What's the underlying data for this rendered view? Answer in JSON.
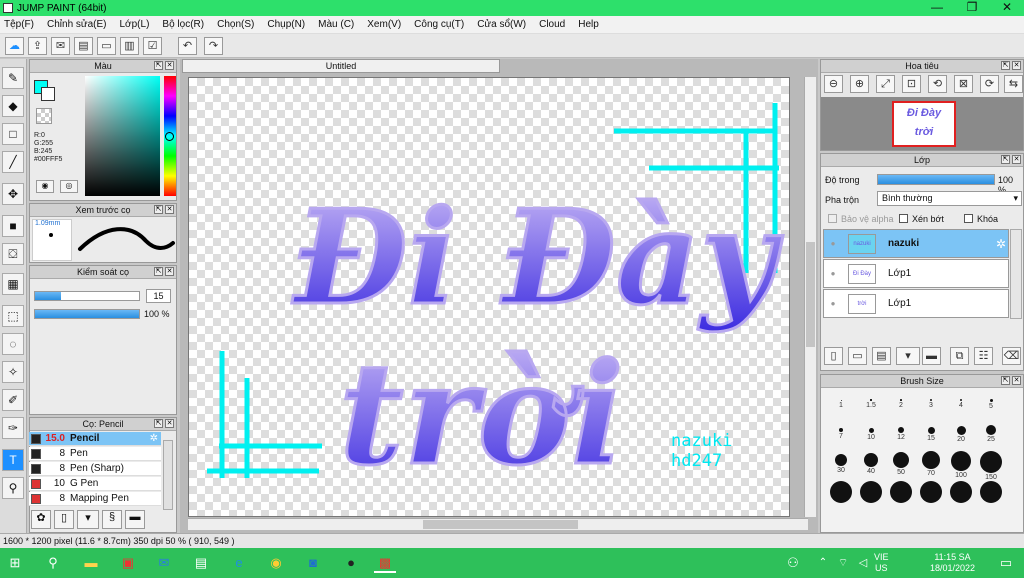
{
  "window": {
    "title": "JUMP PAINT (64bit)",
    "min": "—",
    "max": "❐",
    "close": "✕"
  },
  "menu": [
    "Tệp(F)",
    "Chỉnh sửa(E)",
    "Lớp(L)",
    "Bộ lọc(R)",
    "Chọn(S)",
    "Chụp(N)",
    "Màu (C)",
    "Xem(V)",
    "Công cụ(T)",
    "Cửa sổ(W)",
    "Cloud",
    "Help"
  ],
  "color_panel": {
    "title": "Màu",
    "r": "R:0",
    "g": "G:255",
    "b": "B:245",
    "hex": "#00FFF5",
    "fg": "#00fff5"
  },
  "preview_panel": {
    "title": "Xem trước cọ",
    "size": "1.09mm"
  },
  "brush_control": {
    "title": "Kiểm soát cọ",
    "size_value": "15",
    "opacity_value": "100 %",
    "size_frac": 0.25,
    "opacity_frac": 1.0
  },
  "brush_panel": {
    "title": "Cọ: Pencil",
    "items": [
      {
        "size": "15.0",
        "name": "Pencil",
        "color": "#222222",
        "selected": true
      },
      {
        "size": "8",
        "name": "Pen",
        "color": "#222222"
      },
      {
        "size": "8",
        "name": "Pen (Sharp)",
        "color": "#222222"
      },
      {
        "size": "10",
        "name": "G Pen",
        "color": "#dd3333"
      },
      {
        "size": "8",
        "name": "Mapping Pen",
        "color": "#dd3333"
      }
    ]
  },
  "document": {
    "tab": "Untitled",
    "watermark_line1": "nazuki",
    "watermark_line2": "hd247",
    "art_line1": "Đi Đày",
    "art_line2": "trời"
  },
  "navigator": {
    "title": "Hoa tiêu"
  },
  "layer_panel": {
    "title": "Lớp",
    "opacity_label": "Độ trong",
    "opacity_value": "100 %",
    "opacity_frac": 1.0,
    "blend_label": "Pha trộn",
    "blend_value": "Bình thường",
    "protect_alpha": "Bảo vệ alpha",
    "clip": "Xén bớt",
    "lock": "Khóa",
    "layers": [
      {
        "name": "nazuki",
        "selected": true
      },
      {
        "name": "Lớp1"
      },
      {
        "name": "Lớp1"
      }
    ]
  },
  "brush_size": {
    "title": "Brush Size",
    "sizes": [
      "1",
      "1.5",
      "2",
      "3",
      "4",
      "5",
      "7",
      "10",
      "12",
      "15",
      "20",
      "25",
      "30",
      "40",
      "50",
      "70",
      "100",
      "150",
      "",
      "",
      "",
      "",
      "",
      ""
    ]
  },
  "status": {
    "text": "1600 * 1200 pixel  (11.6 * 8.7cm)  350 dpi  50 %  ( 910, 549 )"
  },
  "taskbar": {
    "lang1": "VIE",
    "lang2": "US",
    "time": "11:15 SA",
    "date": "18/01/2022"
  }
}
